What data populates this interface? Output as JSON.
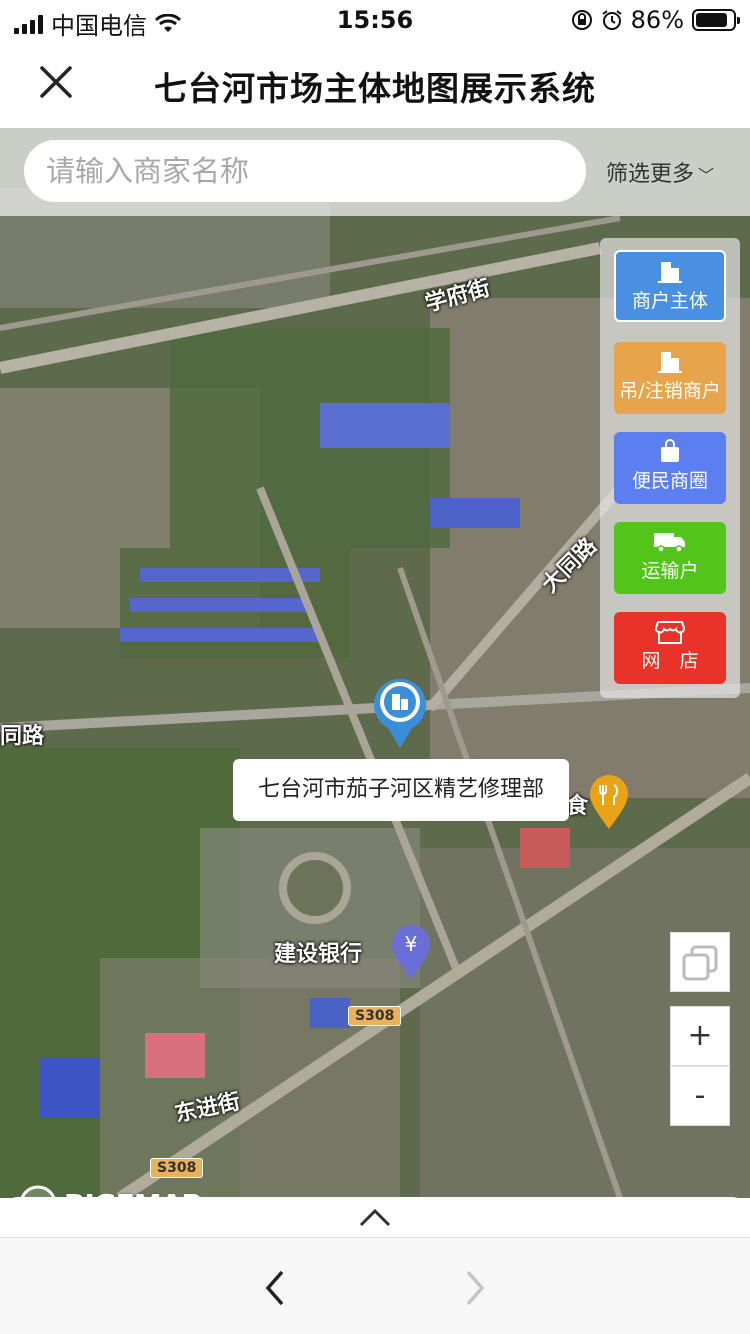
{
  "status_bar": {
    "carrier": "中国电信",
    "time": "15:56",
    "battery_percent": "86%",
    "battery_level": 0.86
  },
  "header": {
    "title": "七台河市场主体地图展示系统"
  },
  "search": {
    "placeholder": "请输入商家名称",
    "filter_label": "筛选更多"
  },
  "categories": [
    {
      "label": "商户主体",
      "color": "#4a90e2",
      "icon": "building-icon"
    },
    {
      "label": "吊/注销商户",
      "color": "#e8a44a",
      "icon": "building-icon"
    },
    {
      "label": "便民商圈",
      "color": "#5b7ff0",
      "icon": "shopping-bag-icon"
    },
    {
      "label": "运输户",
      "color": "#52c41a",
      "icon": "truck-icon"
    },
    {
      "label": "网　店",
      "color": "#e8322a",
      "icon": "storefront-icon"
    }
  ],
  "map": {
    "popup_text": "七台河市茄子河区精艺修理部",
    "labels": {
      "xuefu_street": "学府街",
      "datong_road": "大同路",
      "datong_road_left": "同路",
      "ccb": "建设银行",
      "dongjin_street": "东进街",
      "food_partial": "食"
    },
    "road_badges": [
      "S308",
      "S308"
    ],
    "logo_text": "BIGEMAP"
  },
  "controls": {
    "zoom_in": "+",
    "zoom_out": "-"
  }
}
